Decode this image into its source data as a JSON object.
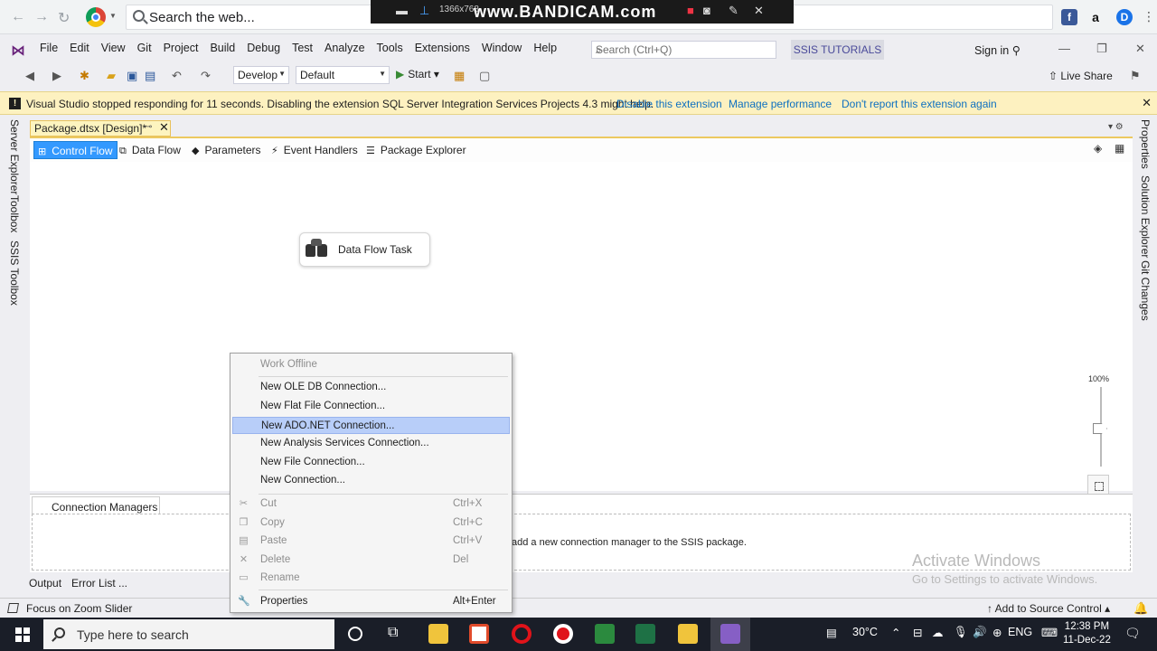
{
  "browser": {
    "search_placeholder": "Search the web...",
    "recorder_resolution": "1366x768",
    "recorder_brand": "www.BANDICAM.com"
  },
  "menu": {
    "items": [
      "File",
      "Edit",
      "View",
      "Git",
      "Project",
      "Build",
      "Debug",
      "Test",
      "Analyze",
      "Tools",
      "Extensions",
      "Window",
      "Help"
    ],
    "search_placeholder": "Search (Ctrl+Q)",
    "solution_name": "SSIS TUTORIALS",
    "sign_in": "Sign in"
  },
  "toolbar": {
    "config_combo": "Develop",
    "platform_combo": "Default",
    "start_label": "Start",
    "live_share": "Live Share"
  },
  "infobar": {
    "message": "Visual Studio stopped responding for 11 seconds. Disabling the extension SQL Server Integration Services Projects 4.3 might help.",
    "links": [
      "Disable this extension",
      "Manage performance",
      "Don't report this extension again"
    ]
  },
  "left_strip": [
    "Server Explorer",
    "Toolbox",
    "SSIS Toolbox"
  ],
  "right_strip": [
    "Properties",
    "Solution Explorer",
    "Git Changes"
  ],
  "document": {
    "tab_title": "Package.dtsx [Design]*"
  },
  "designer_tabs": [
    "Control Flow",
    "Data Flow",
    "Parameters",
    "Event Handlers",
    "Package Explorer"
  ],
  "canvas": {
    "task_label": "Data Flow Task",
    "zoom_level": "100%"
  },
  "connection_managers": {
    "tab": "Connection Managers",
    "hint": "add a new connection manager to the SSIS package."
  },
  "watermark": {
    "line1": "Activate Windows",
    "line2": "Go to Settings to activate Windows."
  },
  "output_tabs": [
    "Output",
    "Error List ..."
  ],
  "statusbar": {
    "message": "Focus on Zoom Slider",
    "source_control": "Add to Source Control"
  },
  "context_menu": {
    "work_offline": "Work Offline",
    "connections": [
      "New OLE DB Connection...",
      "New Flat File Connection...",
      "New ADO.NET Connection...",
      "New Analysis Services Connection...",
      "New File Connection...",
      "New Connection..."
    ],
    "highlighted_index": 2,
    "edit": [
      {
        "label": "Cut",
        "key": "Ctrl+X"
      },
      {
        "label": "Copy",
        "key": "Ctrl+C"
      },
      {
        "label": "Paste",
        "key": "Ctrl+V"
      },
      {
        "label": "Delete",
        "key": "Del"
      },
      {
        "label": "Rename",
        "key": ""
      }
    ],
    "properties": {
      "label": "Properties",
      "key": "Alt+Enter"
    }
  },
  "taskbar": {
    "search_placeholder": "Type here to search",
    "temperature": "30°C",
    "language": "ENG",
    "time": "12:38 PM",
    "date": "11-Dec-22"
  },
  "colors": {
    "accent": "#3399ff",
    "infobar": "#fdf1c0",
    "doc_tab": "#fdf4bf",
    "menu_highlight": "#b8cef9",
    "taskbar": "#1a1e28"
  }
}
